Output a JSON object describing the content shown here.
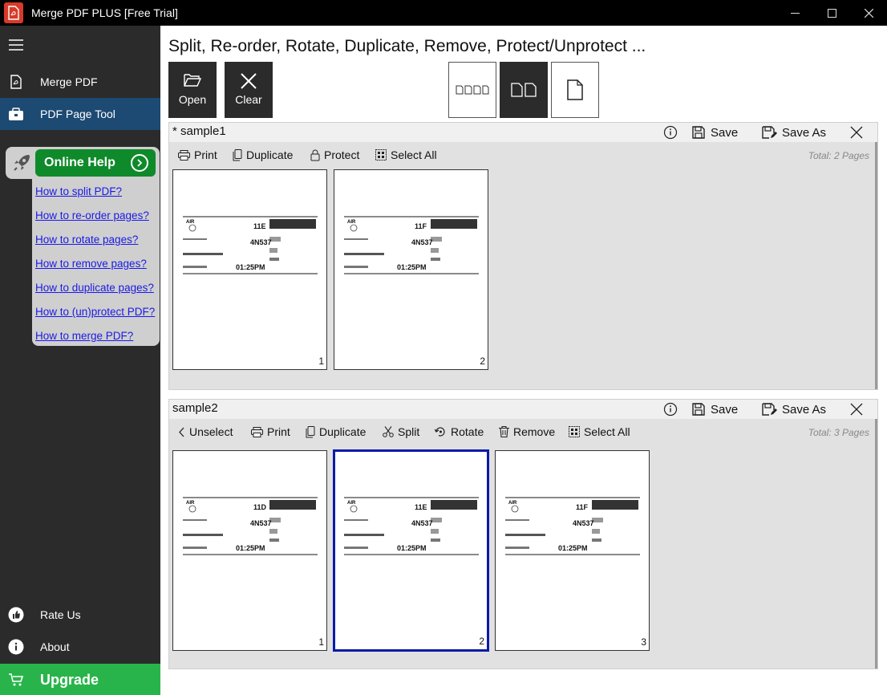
{
  "window": {
    "title": "Merge PDF PLUS [Free Trial]"
  },
  "sidebar": {
    "items": [
      {
        "label": "Merge PDF"
      },
      {
        "label": "PDF Page Tool"
      }
    ],
    "help": {
      "button_label": "Online Help",
      "links": [
        "How to split PDF?",
        "How to re-order pages?",
        "How to rotate pages?",
        "How to remove pages?",
        "How to duplicate pages?",
        "How to (un)protect PDF?",
        "How to merge PDF?"
      ]
    },
    "bottom": {
      "rate_label": "Rate Us",
      "about_label": "About",
      "upgrade_label": "Upgrade"
    },
    "colors": {
      "background": "#2b2b2b",
      "active": "#1d4a73",
      "upgrade": "#29b44b",
      "help_button": "#0f8a2a"
    }
  },
  "main": {
    "title": "Split, Re-order, Rotate, Duplicate, Remove, Protect/Unprotect ...",
    "toolbar": {
      "open_label": "Open",
      "clear_label": "Clear"
    }
  },
  "docs": [
    {
      "name": "* sample1",
      "save_label": "Save",
      "save_as_label": "Save As",
      "tools": [
        "Print",
        "Duplicate",
        "Protect",
        "Select All"
      ],
      "total": "Total: 2 Pages",
      "pages": [
        {
          "number": "1",
          "seat": "11E",
          "flight": "4N537",
          "time": "01:25PM"
        },
        {
          "number": "2",
          "seat": "11F",
          "flight": "4N537",
          "time": "01:25PM"
        }
      ]
    },
    {
      "name": "sample2",
      "save_label": "Save",
      "save_as_label": "Save As",
      "tools": [
        "Unselect",
        "Print",
        "Duplicate",
        "Split",
        "Rotate",
        "Remove",
        "Select All"
      ],
      "total": "Total: 3 Pages",
      "pages": [
        {
          "number": "1",
          "seat": "11D",
          "flight": "4N537",
          "time": "01:25PM"
        },
        {
          "number": "2",
          "seat": "11E",
          "flight": "4N537",
          "time": "01:25PM"
        },
        {
          "number": "3",
          "seat": "11F",
          "flight": "4N537",
          "time": "01:25PM"
        }
      ]
    }
  ]
}
